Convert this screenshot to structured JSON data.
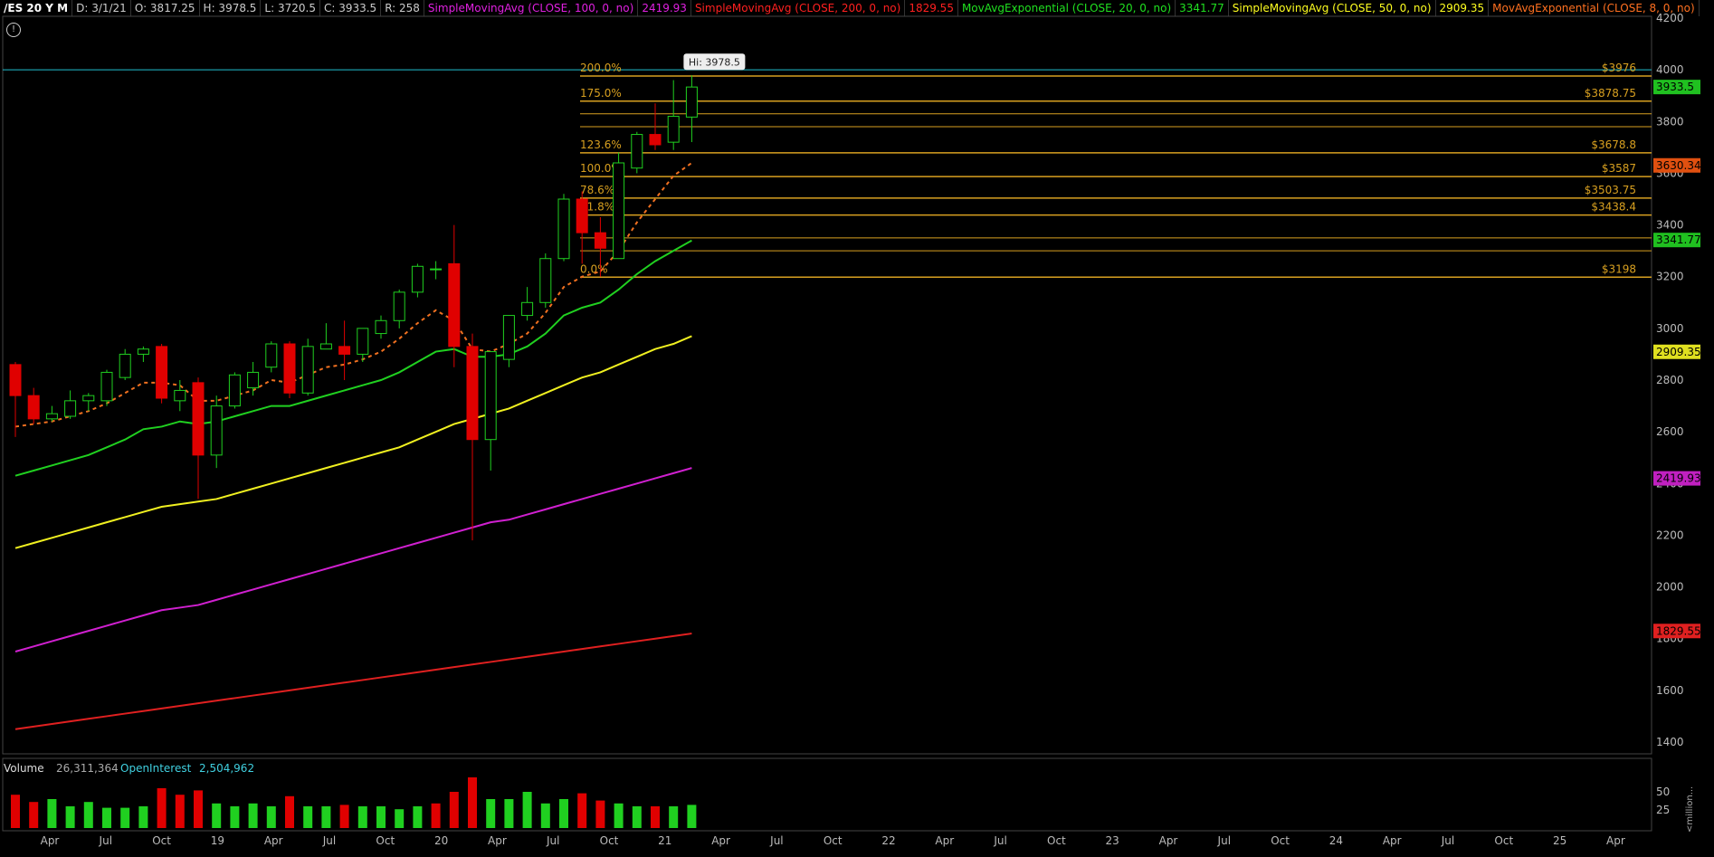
{
  "header": {
    "symbol": "/ES 20 Y M",
    "date": "D: 3/1/21",
    "open": "O: 3817.25",
    "high": "H: 3978.5",
    "low": "L: 3720.5",
    "close": "C: 3933.5",
    "range": "R: 258",
    "studies": [
      {
        "label": "SimpleMovingAvg (CLOSE, 100, 0, no)",
        "value": "2419.93",
        "color": "#e020e0"
      },
      {
        "label": "SimpleMovingAvg (CLOSE, 200, 0, no)",
        "value": "1829.55",
        "color": "#ff2020"
      },
      {
        "label": "MovAvgExponential (CLOSE, 20, 0, no)",
        "value": "3341.77",
        "color": "#20e020"
      },
      {
        "label": "SimpleMovingAvg (CLOSE, 50, 0, no)",
        "value": "2909.35",
        "color": "#ffff20"
      },
      {
        "label": "MovAvgExponential (CLOSE, 8, 0, no)",
        "value": "",
        "color": "#ff7020"
      }
    ]
  },
  "info_icon": "!",
  "volume_panel": {
    "volume_label": "Volume",
    "volume_value": "26,311,364",
    "oi_label": "OpenInterest",
    "oi_value": "2,504,962",
    "unit_label": "<million..."
  },
  "chart_data": {
    "type": "candlestick",
    "price_axis": {
      "min": 1400,
      "max": 4200,
      "ticks": [
        1400,
        1600,
        1800,
        2000,
        2200,
        2400,
        2600,
        2800,
        3000,
        3200,
        3400,
        3600,
        3800,
        4000,
        4200
      ]
    },
    "volume_axis_ticks": [
      25,
      50
    ],
    "x_tick_labels": [
      "Apr",
      "Jul",
      "Oct",
      "19",
      "Apr",
      "Jul",
      "Oct",
      "20",
      "Apr",
      "Jul",
      "Oct",
      "21",
      "Apr",
      "Jul",
      "Oct",
      "22",
      "Apr",
      "Jul",
      "Oct",
      "23",
      "Apr",
      "Jul",
      "Oct",
      "24",
      "Apr",
      "Jul",
      "Oct",
      "25",
      "Apr"
    ],
    "candles": [
      [
        2860,
        2870,
        2580,
        2740
      ],
      [
        2740,
        2770,
        2630,
        2650
      ],
      [
        2650,
        2700,
        2640,
        2670
      ],
      [
        2660,
        2760,
        2650,
        2720
      ],
      [
        2720,
        2750,
        2680,
        2740
      ],
      [
        2720,
        2840,
        2700,
        2830
      ],
      [
        2810,
        2920,
        2800,
        2900
      ],
      [
        2900,
        2930,
        2870,
        2920
      ],
      [
        2930,
        2940,
        2710,
        2730
      ],
      [
        2720,
        2800,
        2680,
        2760
      ],
      [
        2790,
        2810,
        2340,
        2510
      ],
      [
        2510,
        2740,
        2460,
        2700
      ],
      [
        2700,
        2830,
        2690,
        2820
      ],
      [
        2770,
        2870,
        2740,
        2830
      ],
      [
        2850,
        2950,
        2830,
        2940
      ],
      [
        2940,
        2950,
        2730,
        2750
      ],
      [
        2750,
        2960,
        2740,
        2930
      ],
      [
        2920,
        3020,
        2920,
        2940
      ],
      [
        2930,
        3030,
        2800,
        2900
      ],
      [
        2900,
        3000,
        2870,
        3000
      ],
      [
        2980,
        3050,
        2960,
        3030
      ],
      [
        3030,
        3150,
        3000,
        3140
      ],
      [
        3140,
        3250,
        3120,
        3240
      ],
      [
        3230,
        3260,
        3190,
        3230
      ],
      [
        3250,
        3400,
        2850,
        2930
      ],
      [
        2930,
        2980,
        2180,
        2570
      ],
      [
        2570,
        2900,
        2450,
        2910
      ],
      [
        2880,
        3040,
        2850,
        3050
      ],
      [
        3050,
        3160,
        3030,
        3100
      ],
      [
        3100,
        3290,
        3080,
        3270
      ],
      [
        3270,
        3520,
        3260,
        3500
      ],
      [
        3500,
        3530,
        3250,
        3370
      ],
      [
        3370,
        3430,
        3200,
        3310
      ],
      [
        3270,
        3680,
        3270,
        3640
      ],
      [
        3620,
        3760,
        3600,
        3750
      ],
      [
        3750,
        3870,
        3690,
        3710
      ],
      [
        3720,
        3960,
        3690,
        3820
      ],
      [
        3817.25,
        3978.5,
        3720.5,
        3933.5
      ]
    ],
    "volume": [
      {
        "v": 46,
        "up": false
      },
      {
        "v": 36,
        "up": false
      },
      {
        "v": 40,
        "up": true
      },
      {
        "v": 30,
        "up": true
      },
      {
        "v": 36,
        "up": true
      },
      {
        "v": 28,
        "up": true
      },
      {
        "v": 28,
        "up": true
      },
      {
        "v": 30,
        "up": true
      },
      {
        "v": 55,
        "up": false
      },
      {
        "v": 46,
        "up": false
      },
      {
        "v": 52,
        "up": false
      },
      {
        "v": 34,
        "up": true
      },
      {
        "v": 30,
        "up": true
      },
      {
        "v": 34,
        "up": true
      },
      {
        "v": 30,
        "up": true
      },
      {
        "v": 44,
        "up": false
      },
      {
        "v": 30,
        "up": true
      },
      {
        "v": 30,
        "up": true
      },
      {
        "v": 32,
        "up": false
      },
      {
        "v": 30,
        "up": true
      },
      {
        "v": 30,
        "up": true
      },
      {
        "v": 26,
        "up": true
      },
      {
        "v": 30,
        "up": true
      },
      {
        "v": 34,
        "up": false
      },
      {
        "v": 50,
        "up": false
      },
      {
        "v": 70,
        "up": false
      },
      {
        "v": 40,
        "up": true
      },
      {
        "v": 40,
        "up": true
      },
      {
        "v": 50,
        "up": true
      },
      {
        "v": 34,
        "up": true
      },
      {
        "v": 40,
        "up": true
      },
      {
        "v": 48,
        "up": false
      },
      {
        "v": 38,
        "up": false
      },
      {
        "v": 34,
        "up": true
      },
      {
        "v": 30,
        "up": true
      },
      {
        "v": 30,
        "up": false
      },
      {
        "v": 30,
        "up": true
      },
      {
        "v": 32,
        "up": true
      }
    ],
    "ema8": [
      2620,
      2630,
      2640,
      2660,
      2680,
      2710,
      2750,
      2790,
      2790,
      2780,
      2720,
      2720,
      2740,
      2760,
      2800,
      2790,
      2820,
      2850,
      2860,
      2880,
      2910,
      2960,
      3020,
      3070,
      3030,
      2920,
      2910,
      2940,
      2980,
      3060,
      3160,
      3200,
      3220,
      3300,
      3410,
      3500,
      3590,
      3640
    ],
    "ema20": [
      2430,
      2450,
      2470,
      2490,
      2510,
      2540,
      2570,
      2610,
      2620,
      2640,
      2630,
      2640,
      2660,
      2680,
      2700,
      2700,
      2720,
      2740,
      2760,
      2780,
      2800,
      2830,
      2870,
      2910,
      2920,
      2890,
      2890,
      2900,
      2930,
      2980,
      3050,
      3080,
      3100,
      3150,
      3210,
      3260,
      3300,
      3340
    ],
    "sma50": [
      2150,
      2170,
      2190,
      2210,
      2230,
      2250,
      2270,
      2290,
      2310,
      2320,
      2330,
      2340,
      2360,
      2380,
      2400,
      2420,
      2440,
      2460,
      2480,
      2500,
      2520,
      2540,
      2570,
      2600,
      2630,
      2650,
      2670,
      2690,
      2720,
      2750,
      2780,
      2810,
      2830,
      2860,
      2890,
      2920,
      2940,
      2970
    ],
    "sma100": [
      1750,
      1770,
      1790,
      1810,
      1830,
      1850,
      1870,
      1890,
      1910,
      1920,
      1930,
      1950,
      1970,
      1990,
      2010,
      2030,
      2050,
      2070,
      2090,
      2110,
      2130,
      2150,
      2170,
      2190,
      2210,
      2230,
      2250,
      2260,
      2280,
      2300,
      2320,
      2340,
      2360,
      2380,
      2400,
      2420,
      2440,
      2460
    ],
    "sma200": [
      1450,
      1460,
      1470,
      1480,
      1490,
      1500,
      1510,
      1520,
      1530,
      1540,
      1550,
      1560,
      1570,
      1580,
      1590,
      1600,
      1610,
      1620,
      1630,
      1640,
      1650,
      1660,
      1670,
      1680,
      1690,
      1700,
      1710,
      1720,
      1730,
      1740,
      1750,
      1760,
      1770,
      1780,
      1790,
      1800,
      1810,
      1820
    ],
    "fib_levels": [
      {
        "price": 3198,
        "left_label": "0.0%",
        "right_label": "$3198"
      },
      {
        "price": 3300,
        "left_label": "",
        "right_label": ""
      },
      {
        "price": 3350,
        "left_label": "",
        "right_label": ""
      },
      {
        "price": 3438.4,
        "left_label": "61.8%",
        "right_label": "$3438.4"
      },
      {
        "price": 3503.75,
        "left_label": "78.6%",
        "right_label": "$3503.75"
      },
      {
        "price": 3587,
        "left_label": "100.0%",
        "right_label": "$3587"
      },
      {
        "price": 3678.8,
        "left_label": "123.6%",
        "right_label": "$3678.8"
      },
      {
        "price": 3780,
        "left_label": "",
        "right_label": ""
      },
      {
        "price": 3830,
        "left_label": "",
        "right_label": ""
      },
      {
        "price": 3878.75,
        "left_label": "175.0%",
        "right_label": "$3878.75"
      },
      {
        "price": 3976,
        "left_label": "200.0%",
        "right_label": "$3976"
      }
    ],
    "hi_bubble": "Hi: 3978.5",
    "cyan_line_price": 4000,
    "price_badges": [
      {
        "price": 3933.5,
        "label": "3933.5",
        "color": "#20c020"
      },
      {
        "price": 3630.34,
        "label": "3630.34",
        "color": "#e05010"
      },
      {
        "price": 3341.77,
        "label": "3341.77",
        "color": "#20c020"
      },
      {
        "price": 2909.35,
        "label": "2909.35",
        "color": "#e0e020"
      },
      {
        "price": 2419.93,
        "label": "2419.93",
        "color": "#c020c0"
      },
      {
        "price": 1829.55,
        "label": "1829.55",
        "color": "#e02020"
      }
    ]
  }
}
